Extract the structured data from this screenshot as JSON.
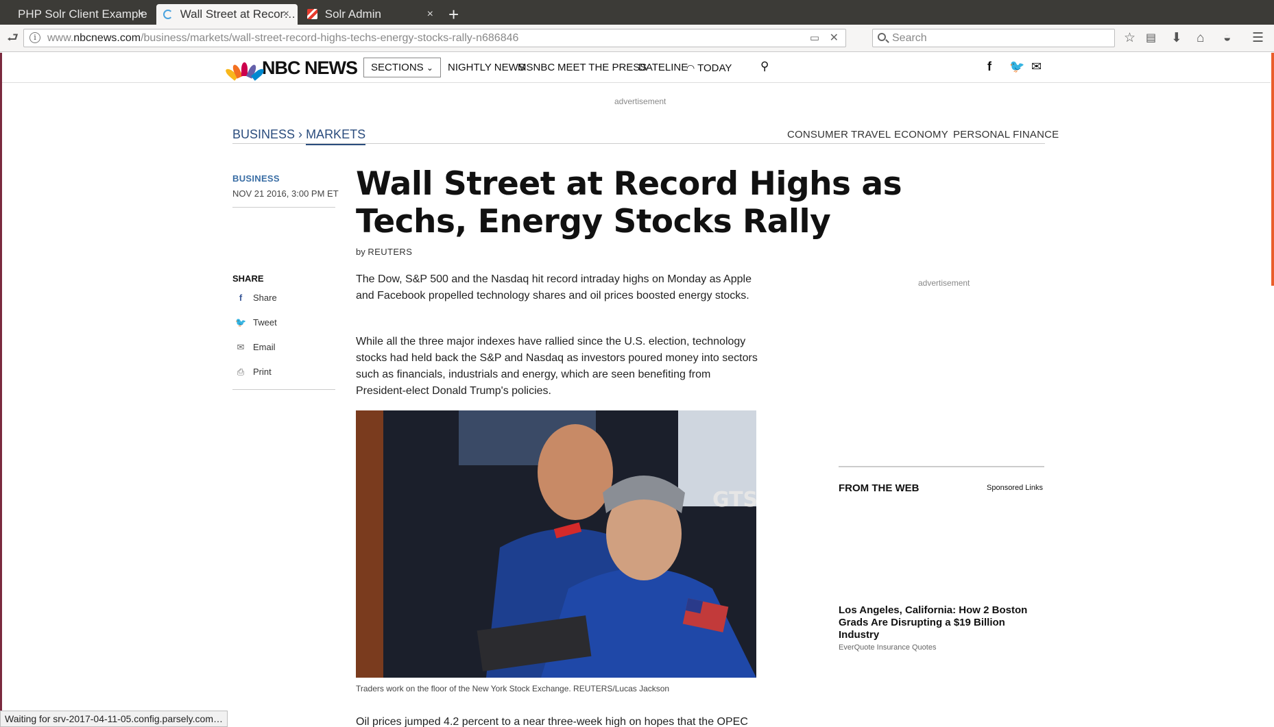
{
  "browser": {
    "tabs": [
      {
        "title": "PHP Solr Client Example",
        "close": "×"
      },
      {
        "title": "Wall Street at Recor…",
        "close": "×"
      },
      {
        "title": "Solr Admin",
        "close": "×"
      }
    ],
    "new_tab": "+",
    "url_prefix": "www.",
    "url_domain": "nbcnews.com",
    "url_path": "/business/markets/wall-street-record-highs-techs-energy-stocks-rally-n686846",
    "search_placeholder": "Search",
    "status": "Waiting for srv-2017-04-11-05.config.parsely.com…"
  },
  "site": {
    "logo": "NBC NEWS",
    "sections_label": "SECTIONS",
    "nav": [
      "NIGHTLY NEWS",
      "MSNBC",
      "MEET THE PRESS",
      "DATELINE",
      "TODAY"
    ],
    "ad_label": "advertisement"
  },
  "breadcrumb": {
    "parent": "BUSINESS",
    "sep": "›",
    "current": "MARKETS"
  },
  "subnav": [
    "CONSUMER",
    "TRAVEL",
    "ECONOMY",
    "PERSONAL FINANCE"
  ],
  "article": {
    "category": "BUSINESS",
    "date": "NOV 21 2016, 3:00 PM ET",
    "headline": "Wall Street at Record Highs as Techs, Energy Stocks Rally",
    "by": "by",
    "author": "REUTERS",
    "paragraphs": [
      "The Dow, S&P 500 and the Nasdaq hit record intraday highs on Monday as Apple and Facebook propelled technology shares and oil prices boosted energy stocks.",
      "While all the three major indexes have rallied since the U.S. election, technology stocks had held back the S&P and Nasdaq as investors poured money into sectors such as financials, industrials and energy, which are seen benefiting from President-elect Donald Trump's policies.",
      "Oil prices jumped 4.2 percent to a near three-week high on hopes that the OPEC"
    ],
    "caption": "Traders work on the floor of the New York Stock Exchange. REUTERS/Lucas Jackson"
  },
  "share": {
    "heading": "SHARE",
    "items": [
      "Share",
      "Tweet",
      "Email",
      "Print"
    ]
  },
  "sidebar": {
    "ad_label": "advertisement",
    "from_web": "FROM THE WEB",
    "sponsored": "Sponsored Links",
    "promo_title": "Los Angeles, California: How 2 Boston Grads Are Disrupting a $19 Billion Industry",
    "promo_source": "EverQuote Insurance Quotes"
  }
}
